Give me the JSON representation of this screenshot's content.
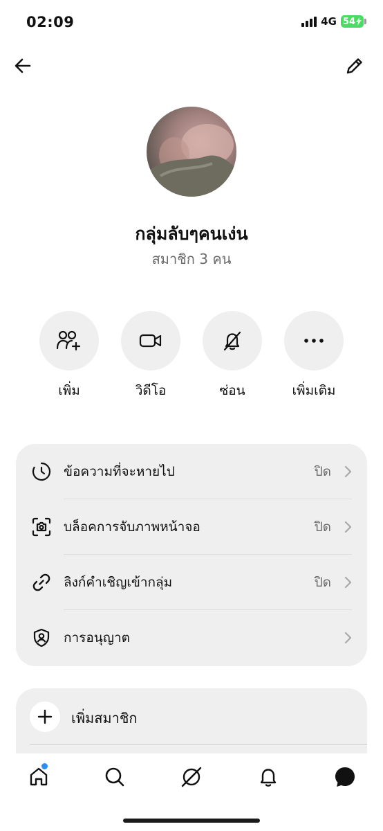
{
  "status_bar": {
    "time": "02:09",
    "network": "4G",
    "battery": "54",
    "battery_color": "#4cd964"
  },
  "header": {
    "back_icon": "arrow-left-icon",
    "edit_icon": "pencil-icon"
  },
  "group": {
    "name": "กลุ่มลับๆคนเง่น",
    "member_count": "สมาชิก 3 คน"
  },
  "actions": [
    {
      "label": "เพิ่ม",
      "icon": "add-people-icon"
    },
    {
      "label": "วิดีโอ",
      "icon": "video-camera-icon"
    },
    {
      "label": "ซ่อน",
      "icon": "bell-off-icon"
    },
    {
      "label": "เพิ่มเติม",
      "icon": "more-dots-icon"
    }
  ],
  "settings": [
    {
      "label": "ข้อความที่จะหายไป",
      "value": "ปิด",
      "icon": "timer-icon"
    },
    {
      "label": "บล็อคการจับภาพหน้าจอ",
      "value": "ปิด",
      "icon": "screenshot-camera-icon"
    },
    {
      "label": "ลิงก์คำเชิญเข้ากลุ่ม",
      "value": "ปิด",
      "icon": "link-icon"
    },
    {
      "label": "การอนุญาต",
      "value": "",
      "icon": "shield-person-icon"
    }
  ],
  "add_member": {
    "label": "เพิ่มสมาชิก",
    "icon": "plus-icon"
  },
  "bottom_nav": {
    "items": [
      "home-icon",
      "search-icon",
      "explore-icon",
      "notifications-icon",
      "messages-icon"
    ],
    "accent": "#2f8cf0"
  }
}
